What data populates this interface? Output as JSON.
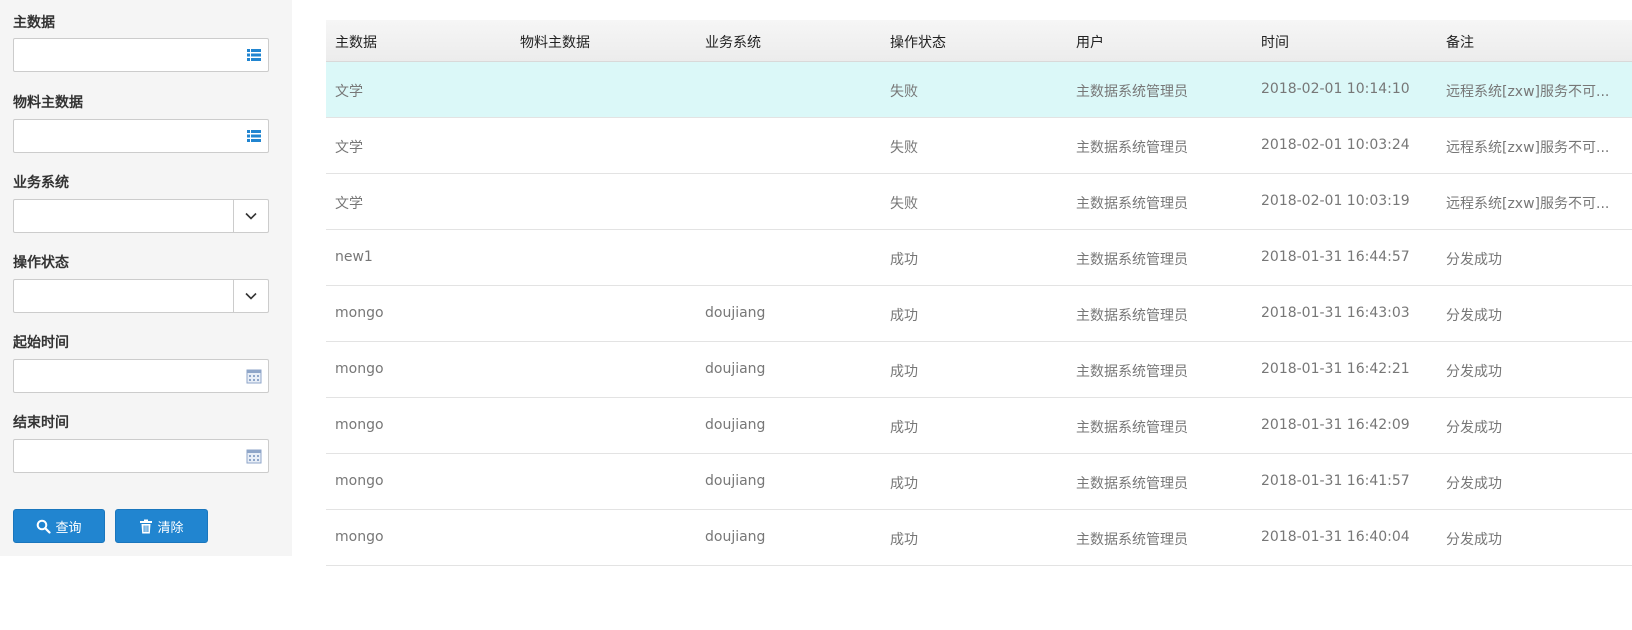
{
  "filters": {
    "master_data_label": "主数据",
    "material_master_label": "物料主数据",
    "business_system_label": "业务系统",
    "operation_status_label": "操作状态",
    "start_time_label": "起始时间",
    "end_time_label": "结束时间",
    "master_data_value": "",
    "material_master_value": "",
    "business_system_value": "",
    "operation_status_value": "",
    "start_time_value": "",
    "end_time_value": ""
  },
  "buttons": {
    "query_label": "查询",
    "clear_label": "清除"
  },
  "colors": {
    "accent": "#2185d0",
    "selected_row": "#dbf8f8",
    "sidebar_bg": "#f5f5f5"
  },
  "table": {
    "columns": [
      "主数据",
      "物料主数据",
      "业务系统",
      "操作状态",
      "用户",
      "时间",
      "备注"
    ],
    "rows": [
      {
        "master": "文学",
        "material": "",
        "system": "",
        "status": "失败",
        "user": "主数据系统管理员",
        "time": "2018-02-01 10:14:10",
        "remark": "远程系统[zxw]服务不可..."
      },
      {
        "master": "文学",
        "material": "",
        "system": "",
        "status": "失败",
        "user": "主数据系统管理员",
        "time": "2018-02-01 10:03:24",
        "remark": "远程系统[zxw]服务不可..."
      },
      {
        "master": "文学",
        "material": "",
        "system": "",
        "status": "失败",
        "user": "主数据系统管理员",
        "time": "2018-02-01 10:03:19",
        "remark": "远程系统[zxw]服务不可..."
      },
      {
        "master": "new1",
        "material": "",
        "system": "",
        "status": "成功",
        "user": "主数据系统管理员",
        "time": "2018-01-31 16:44:57",
        "remark": "分发成功"
      },
      {
        "master": "mongo",
        "material": "",
        "system": "doujiang",
        "status": "成功",
        "user": "主数据系统管理员",
        "time": "2018-01-31 16:43:03",
        "remark": "分发成功"
      },
      {
        "master": "mongo",
        "material": "",
        "system": "doujiang",
        "status": "成功",
        "user": "主数据系统管理员",
        "time": "2018-01-31 16:42:21",
        "remark": "分发成功"
      },
      {
        "master": "mongo",
        "material": "",
        "system": "doujiang",
        "status": "成功",
        "user": "主数据系统管理员",
        "time": "2018-01-31 16:42:09",
        "remark": "分发成功"
      },
      {
        "master": "mongo",
        "material": "",
        "system": "doujiang",
        "status": "成功",
        "user": "主数据系统管理员",
        "time": "2018-01-31 16:41:57",
        "remark": "分发成功"
      },
      {
        "master": "mongo",
        "material": "",
        "system": "doujiang",
        "status": "成功",
        "user": "主数据系统管理员",
        "time": "2018-01-31 16:40:04",
        "remark": "分发成功"
      }
    ]
  }
}
